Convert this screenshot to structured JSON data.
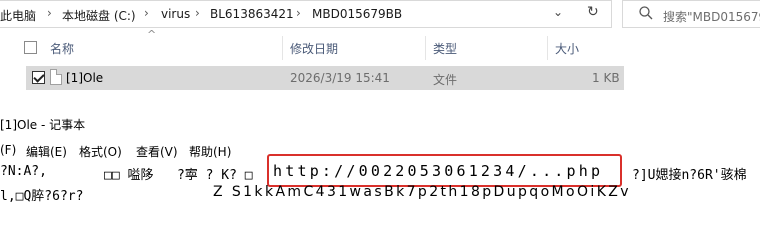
{
  "explorer": {
    "breadcrumb": [
      "此电脑",
      "本地磁盘 (C:)",
      "virus",
      "BL613863421",
      "MBD015679BB"
    ],
    "breadcrumb_separator": "›",
    "search_placeholder": "搜索\"MBD015679",
    "columns": {
      "name": "名称",
      "date": "修改日期",
      "type": "类型",
      "size": "大小"
    },
    "files": [
      {
        "name": "[1]Ole",
        "date": "2026/3/19 15:41",
        "type": "文件",
        "size": "1 KB"
      }
    ]
  },
  "notepad": {
    "title": "[1]Ole - 记事本",
    "menu": [
      "(F)",
      "编辑(E)",
      "格式(O)",
      "查看(V)",
      "帮助(H)"
    ],
    "line1_left": "?N:A?,",
    "line1_mid": "□□ 嗌陊   ?寕 ? K? □",
    "url": "http://0022053061234/...php",
    "line1_right": "?]U媤接n?6R'骇棉",
    "line2_left": "l,□Q脺?6?r?",
    "line2_right": "Z S1kkAmC431wasBk7p2th18pDupqoMoOiKZv",
    "highlight_color": "#d9302b"
  }
}
